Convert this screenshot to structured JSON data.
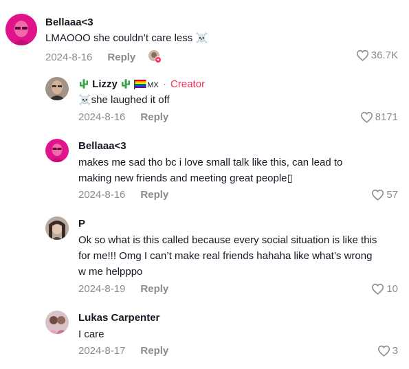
{
  "comments": [
    {
      "username": "Bellaaa<3",
      "text": "LMAOOO she couldn’t care less ☠️",
      "date": "2024-8-16",
      "reply_label": "Reply",
      "likes": "36.7K"
    },
    {
      "username": "Lizzy",
      "flag_tag": "MX",
      "creator_label": "Creator",
      "separator": "·",
      "text": "☠️she laughed it off",
      "date": "2024-8-16",
      "reply_label": "Reply",
      "likes": "8171"
    },
    {
      "username": "Bellaaa<3",
      "text_line1": "makes me sad tho bc i love small talk like this, can lead to",
      "text_line2": "making new friends and meeting great people▯",
      "date": "2024-8-16",
      "reply_label": "Reply",
      "likes": "57"
    },
    {
      "username": "P",
      "text_line1": "Ok so what is this called because every social situation is like this",
      "text_line2": "for me!!! Omg I can’t make real friends hahaha like what’s wrong",
      "text_line3": "w me helpppo",
      "date": "2024-8-19",
      "reply_label": "Reply",
      "likes": "10"
    },
    {
      "username": "Lukas Carpenter",
      "text": "I care",
      "date": "2024-8-17",
      "reply_label": "Reply",
      "likes": "3"
    }
  ],
  "colors": {
    "creator": "#fe2c55",
    "muted": "#8a8b91",
    "text": "#161823"
  }
}
